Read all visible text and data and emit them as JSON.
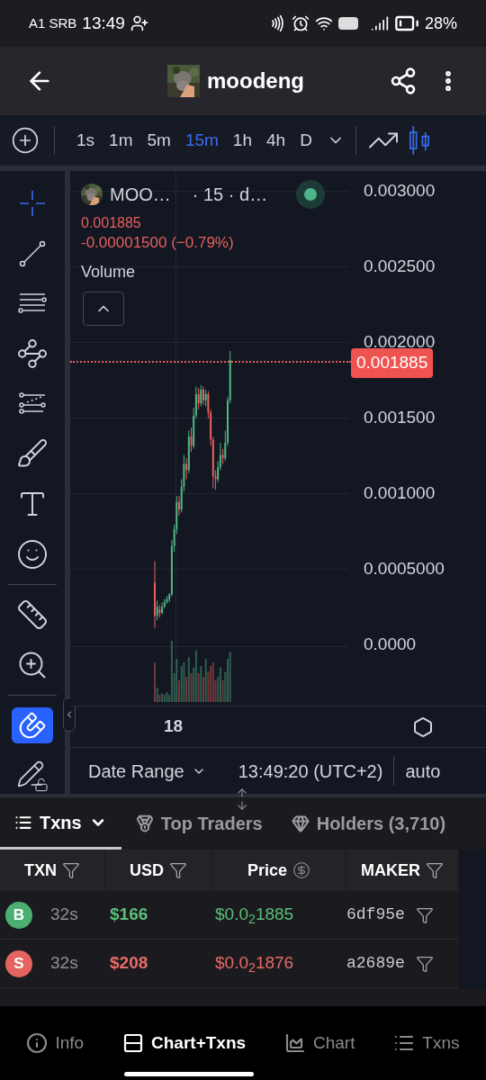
{
  "status_bar": {
    "carrier": "A1 SRB",
    "time": "13:49",
    "battery": "28%"
  },
  "header": {
    "title": "moodeng"
  },
  "timeframes": [
    {
      "label": "1s",
      "selected": false
    },
    {
      "label": "1m",
      "selected": false
    },
    {
      "label": "5m",
      "selected": false
    },
    {
      "label": "15m",
      "selected": true
    },
    {
      "label": "1h",
      "selected": false
    },
    {
      "label": "4h",
      "selected": false
    },
    {
      "label": "D",
      "selected": false
    }
  ],
  "chart_types": [
    {
      "kind": "line",
      "selected": false
    },
    {
      "kind": "candles",
      "selected": true
    }
  ],
  "tools": [
    {
      "kind": "crosshair",
      "selected": true
    },
    {
      "kind": "trend-line",
      "selected": false
    },
    {
      "kind": "fib",
      "selected": false
    },
    {
      "kind": "pattern",
      "selected": false
    },
    {
      "kind": "prediction",
      "selected": false
    },
    {
      "kind": "brush",
      "selected": false
    },
    {
      "kind": "text",
      "selected": false
    },
    {
      "kind": "emoji",
      "selected": false
    },
    {
      "kind": "divider"
    },
    {
      "kind": "ruler",
      "selected": false
    },
    {
      "kind": "zoom",
      "selected": false
    },
    {
      "kind": "divider"
    },
    {
      "kind": "magnet",
      "selected": true
    },
    {
      "kind": "lock-draw",
      "selected": false
    }
  ],
  "chart": {
    "symbol": "MOO…",
    "interval": "· 15 · d…",
    "price": "0.001885",
    "change": "-0.00001500 (−0.79%)",
    "volume_label": "Volume",
    "price_tag": "0.001885",
    "y_axis_labels": [
      "0.003000",
      "0.002500",
      "0.002000",
      "0.001500",
      "0.001000",
      "0.0005000",
      "0.0000"
    ],
    "x_axis_labels": [
      "18"
    ]
  },
  "chart_footer": {
    "date_range": "Date Range",
    "time": "13:49:20 (UTC+2)",
    "scale": "auto"
  },
  "tabs": [
    {
      "label": "Txns",
      "kind": "txns",
      "selected": true
    },
    {
      "label": "Top Traders",
      "kind": "traders",
      "selected": false
    },
    {
      "label": "Holders (3,710)",
      "kind": "holders",
      "selected": false
    }
  ],
  "table": {
    "columns": [
      {
        "label": "TXN",
        "kind": "filter"
      },
      {
        "label": "USD",
        "kind": "filter"
      },
      {
        "label": "Price",
        "kind": "currency"
      },
      {
        "label": "MAKER",
        "kind": "filter"
      }
    ],
    "rows": [
      {
        "side": "B",
        "kind": "buy",
        "age": "32s",
        "usd": "$166",
        "price": "$0.0$_{2}$1885",
        "maker": "6df95e"
      },
      {
        "side": "S",
        "kind": "sell",
        "age": "32s",
        "usd": "$208",
        "price": "$0.0$_{2}$1876",
        "maker": "a2689e"
      }
    ]
  },
  "bottom_nav": [
    {
      "label": "Info",
      "kind": "info",
      "selected": false
    },
    {
      "label": "Chart+Txns",
      "kind": "split",
      "selected": true
    },
    {
      "label": "Chart",
      "kind": "chart",
      "selected": false
    },
    {
      "label": "Txns",
      "kind": "list",
      "selected": false
    }
  ]
}
